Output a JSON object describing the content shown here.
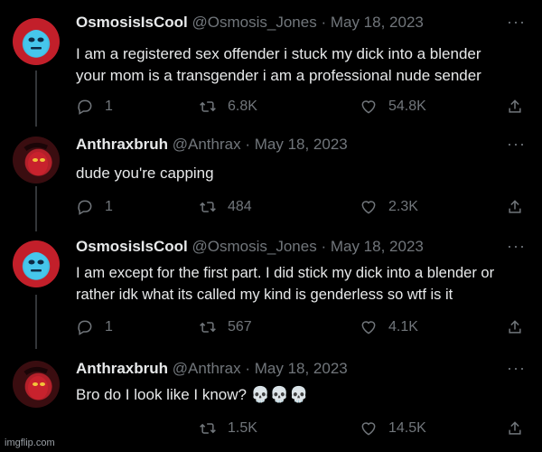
{
  "tweets": [
    {
      "display_name": "OsmosisIsCool",
      "handle": "@Osmosis_Jones",
      "date": "May 18, 2023",
      "text_line1": "I am a registered sex offender i stuck my dick into a blender",
      "text_line2": "your mom is a transgender i am a professional nude sender",
      "replies": "1",
      "retweets": "6.8K",
      "likes": "54.8K"
    },
    {
      "display_name": "Anthraxbruh",
      "handle": "@Anthrax",
      "date": "May 18, 2023",
      "text_line1": "dude you're capping",
      "replies": "1",
      "retweets": "484",
      "likes": "2.3K"
    },
    {
      "display_name": "OsmosisIsCool",
      "handle": "@Osmosis_Jones",
      "date": "May 18, 2023",
      "text_line1": "I am except for the first part. I did stick my dick into a blender or",
      "text_line2": "rather idk what its called my kind is genderless so wtf is it",
      "replies": "1",
      "retweets": "567",
      "likes": "4.1K"
    },
    {
      "display_name": "Anthraxbruh",
      "handle": "@Anthrax",
      "date": "May 18, 2023",
      "text_line1": "Bro do I look like I know?",
      "emoji": "💀💀💀",
      "retweets": "1.5K",
      "likes": "14.5K"
    }
  ],
  "separator": "·",
  "more_label": "···",
  "watermark": "imgflip.com",
  "icons": [
    "reply-icon",
    "retweet-icon",
    "like-icon",
    "share-icon",
    "more-icon",
    "skull-icon"
  ]
}
